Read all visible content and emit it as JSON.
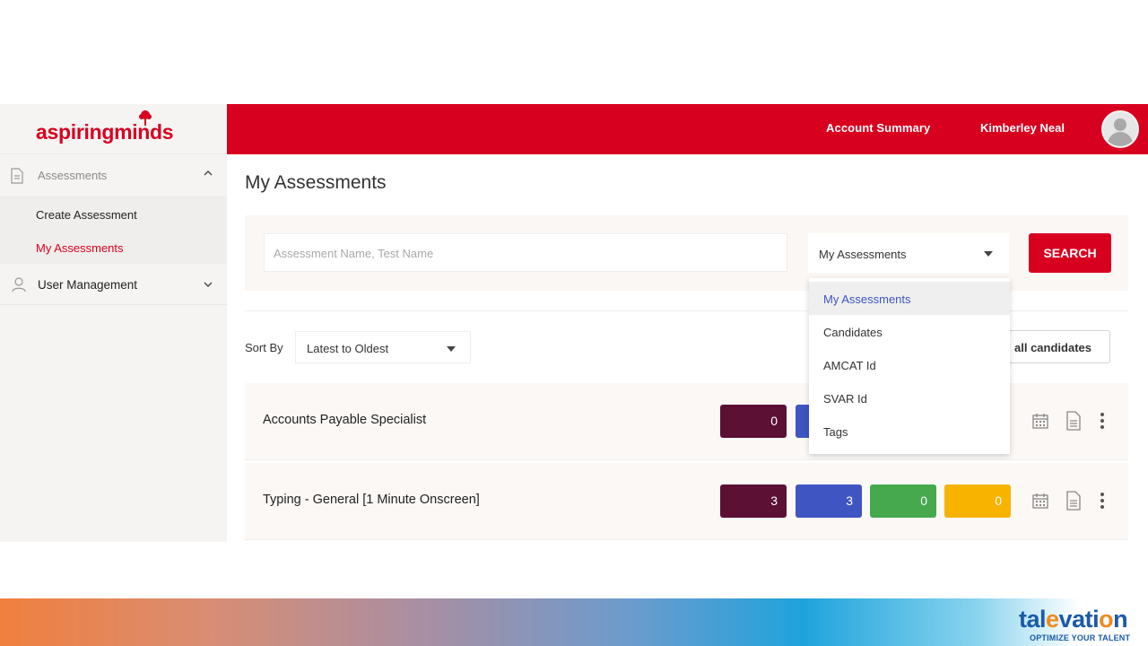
{
  "header": {
    "account_summary": "Account Summary",
    "user_name": "Kimberley Neal"
  },
  "logo": {
    "part1": "aspiring",
    "part2": "minds"
  },
  "sidebar": {
    "assessments": "Assessments",
    "create_assessment": "Create Assessment",
    "my_assessments": "My Assessments",
    "user_management": "User Management"
  },
  "main": {
    "page_title": "My Assessments",
    "search": {
      "placeholder": "Assessment Name, Test Name",
      "filter_value": "My Assessments",
      "button": "SEARCH"
    },
    "sort": {
      "label": "Sort By",
      "value": "Latest to Oldest"
    },
    "all_candidates_button": "all candidates",
    "dropdown_options": [
      "My Assessments",
      "Candidates",
      "AMCAT Id",
      "SVAR Id",
      "Tags"
    ],
    "assessments": [
      {
        "name": "Accounts Payable Specialist",
        "counts": [
          "0"
        ]
      },
      {
        "name": "Typing - General [1 Minute Onscreen]",
        "counts": [
          "3",
          "3",
          "0",
          "0"
        ]
      }
    ]
  },
  "colors": {
    "brand_red": "#d8001f",
    "purple": "#5b1034",
    "blue": "#3f55c1",
    "green": "#46a94e",
    "yellow": "#f8b300"
  },
  "footer": {
    "brand_name_1": "tal",
    "brand_name_2": "e",
    "brand_name_3": "vati",
    "brand_name_4": "o",
    "brand_name_5": "n",
    "tagline": "OPTIMIZE YOUR TALENT"
  }
}
